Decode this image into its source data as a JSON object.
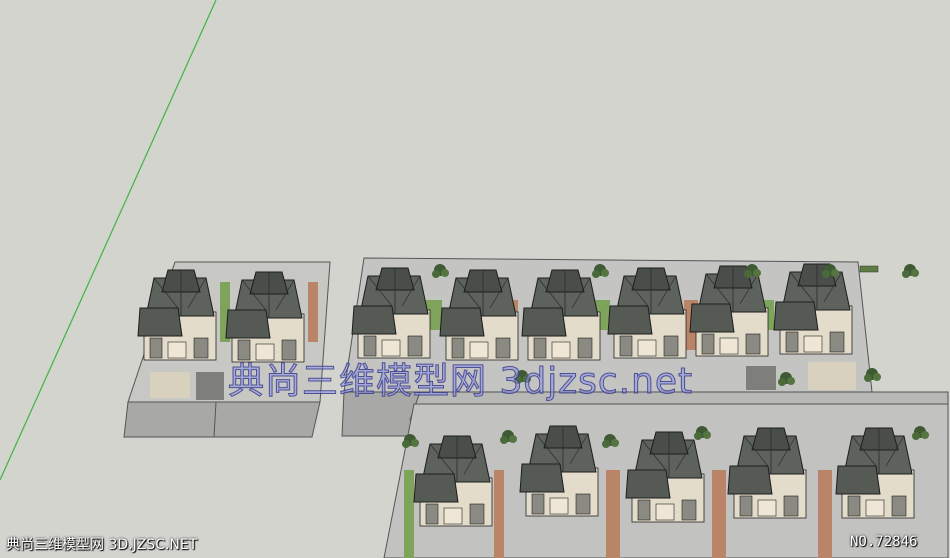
{
  "watermark": {
    "center_text": "典尚三维模型网 3djzsc.net",
    "bottom_left_text": "典尚三维模型网 3D.JZSC.NET",
    "bottom_right_text": "NO.72846"
  },
  "colors": {
    "background": "#d4d4cf",
    "axis_line": "#3fb53f",
    "roof": "#5d625c",
    "roof_dark": "#3e423e",
    "wall": "#e4dccb",
    "ground_pad": "#bcbcbc",
    "grass": "#7ea35a",
    "path": "#b98467"
  }
}
